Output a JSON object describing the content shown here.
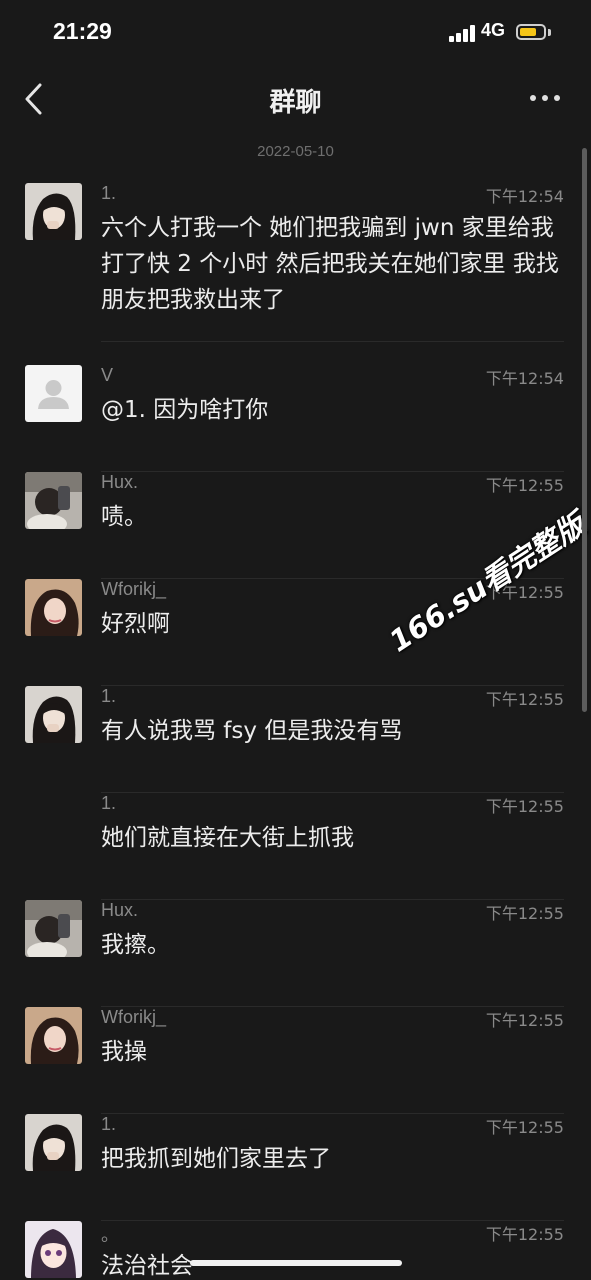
{
  "status_bar": {
    "time": "21:29",
    "network": "4G",
    "battery_color": "#f5c518"
  },
  "nav": {
    "title": "群聊",
    "back_icon": "chevron-left-icon",
    "more_icon": "more-dots-icon"
  },
  "date_stamp": "2022-05-10",
  "watermark": "166.su看完整版",
  "messages": [
    {
      "sender": "1.",
      "time": "下午12:54",
      "text": "六个人打我一个 她们把我骗到 jwn 家里给我打了快 2 个小时 然后把我关在她们家里 我找朋友把我救出来了",
      "avatar": "girl-1"
    },
    {
      "sender": "V",
      "time": "下午12:54",
      "text": "@1. 因为啥打你",
      "avatar": "default"
    },
    {
      "sender": "Hux.",
      "time": "下午12:55",
      "text": "啧。",
      "avatar": "selfie"
    },
    {
      "sender": "Wforikj_",
      "time": "下午12:55",
      "text": "好烈啊",
      "avatar": "girl-2"
    },
    {
      "sender": "1.",
      "time": "下午12:55",
      "text": "有人说我骂 fsy 但是我没有骂",
      "avatar": "girl-1"
    },
    {
      "sender": "1.",
      "time": "下午12:55",
      "text": "她们就直接在大街上抓我",
      "avatar": "none"
    },
    {
      "sender": "Hux.",
      "time": "下午12:55",
      "text": "我擦。",
      "avatar": "selfie"
    },
    {
      "sender": "Wforikj_",
      "time": "下午12:55",
      "text": "我操",
      "avatar": "girl-2"
    },
    {
      "sender": "1.",
      "time": "下午12:55",
      "text": "把我抓到她们家里去了",
      "avatar": "girl-1"
    },
    {
      "sender": "。",
      "time": "下午12:55",
      "text": "法治社会",
      "avatar": "anime"
    }
  ]
}
